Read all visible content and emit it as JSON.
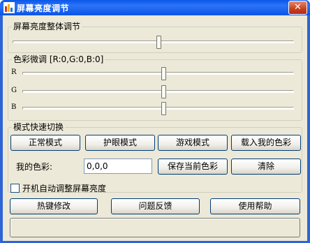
{
  "window": {
    "title": "屏幕亮度调节",
    "close_glyph": "✕"
  },
  "brightness": {
    "title": "屏幕亮度整体调节",
    "level_percent": 52
  },
  "color_tuning": {
    "title": "色彩微调 [R:0,G:0,B:0]",
    "channels": [
      {
        "label": "R",
        "level_percent": 52
      },
      {
        "label": "G",
        "level_percent": 52
      },
      {
        "label": "B",
        "level_percent": 52
      }
    ]
  },
  "mode_switch": {
    "title": "模式快速切换",
    "buttons": [
      "正常模式",
      "护眼模式",
      "游戏模式",
      "载入我的色彩"
    ],
    "my_color_label": "我的色彩:",
    "my_color_value": "0,0,0",
    "save_label": "保存当前色彩",
    "clear_label": "清除"
  },
  "autostart": {
    "label": "开机自动调整屏幕亮度",
    "checked": false
  },
  "bottom_buttons": [
    "热键修改",
    "问题反馈",
    "使用帮助"
  ],
  "status_text": "",
  "colors": {
    "titlebar_blue": "#0a56e8",
    "dialog_bg": "#ece9d8",
    "button_border": "#003c74"
  }
}
